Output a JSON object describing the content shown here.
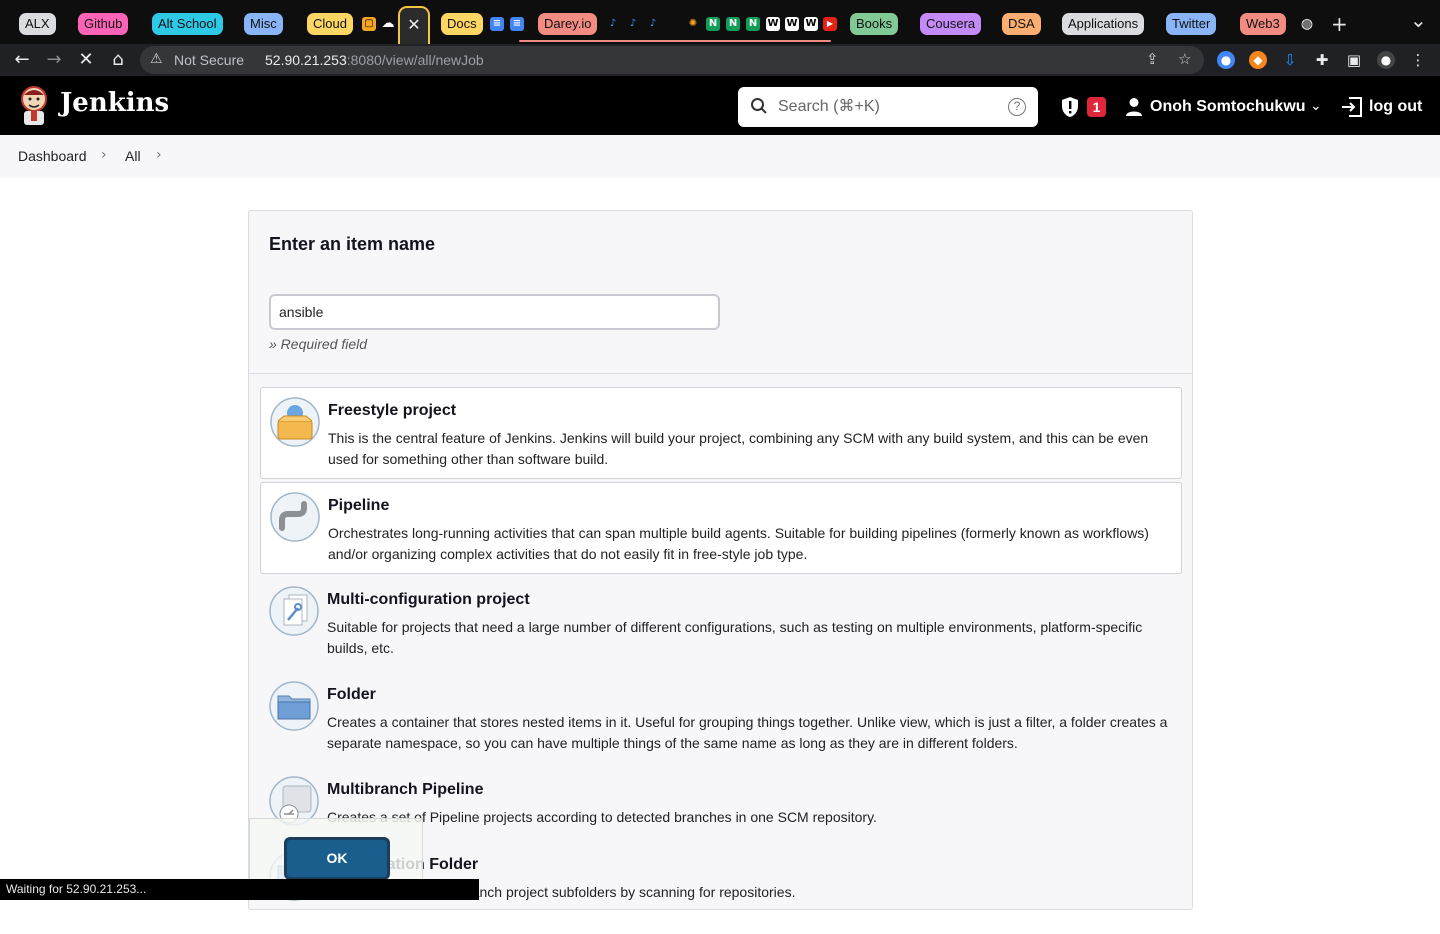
{
  "browser": {
    "tab_groups": [
      {
        "label": "ALX",
        "color": "#dadce0"
      },
      {
        "label": "Github",
        "color": "#ff63b8"
      },
      {
        "label": "Alt School",
        "color": "#2ec9e6"
      },
      {
        "label": "Misc",
        "color": "#8ab4f8"
      },
      {
        "label": "Cloud",
        "color": "#fdd663"
      },
      {
        "label": "Docs",
        "color": "#fdd663"
      },
      {
        "label": "Darey.io",
        "color": "#f28b82"
      },
      {
        "label": "Books",
        "color": "#81c995"
      },
      {
        "label": "Cousera",
        "color": "#c58af9"
      },
      {
        "label": "DSA",
        "color": "#fcad70"
      },
      {
        "label": "Applications",
        "color": "#dadce0"
      },
      {
        "label": "Twitter",
        "color": "#8ab4f8"
      },
      {
        "label": "Web3",
        "color": "#f28b82"
      }
    ],
    "active_tab_close": "✕",
    "new_tab": "+",
    "tab_list": "⌄",
    "address": {
      "security_label": "Not Secure",
      "host": "52.90.21.253",
      "path": ":8080/view/all/newJob"
    }
  },
  "jenkins": {
    "brand": "Jenkins",
    "search_placeholder": "Search (⌘+K)",
    "search_help": "?",
    "alert_count": "1",
    "user_name": "Onoh Somtochukwu",
    "logout_label": "log out"
  },
  "breadcrumb": {
    "items": [
      "Dashboard",
      "All"
    ]
  },
  "new_item": {
    "title": "Enter an item name",
    "name_value": "ansible",
    "required_hint": "» Required field",
    "types": [
      {
        "name": "Freestyle project",
        "desc": "This is the central feature of Jenkins. Jenkins will build your project, combining any SCM with any build system, and this can be even used for something other than software build.",
        "icon": "freestyle-project-icon"
      },
      {
        "name": "Pipeline",
        "desc": "Orchestrates long-running activities that can span multiple build agents. Suitable for building pipelines (formerly known as workflows) and/or organizing complex activities that do not easily fit in free-style job type.",
        "icon": "pipeline-icon"
      },
      {
        "name": "Multi-configuration project",
        "desc": "Suitable for projects that need a large number of different configurations, such as testing on multiple environments, platform-specific builds, etc.",
        "icon": "multi-configuration-icon"
      },
      {
        "name": "Folder",
        "desc": "Creates a container that stores nested items in it. Useful for grouping things together. Unlike view, which is just a filter, a folder creates a separate namespace, so you can have multiple things of the same name as long as they are in different folders.",
        "icon": "folder-icon"
      },
      {
        "name": "Multibranch Pipeline",
        "desc": "Creates a set of Pipeline projects according to detected branches in one SCM repository.",
        "icon": "multibranch-pipeline-icon"
      },
      {
        "name": "Organization Folder",
        "desc": "Creates a set of multibranch project subfolders by scanning for repositories.",
        "icon": "organization-folder-icon"
      }
    ],
    "ok_label": "OK"
  },
  "status_bar": "Waiting for 52.90.21.253..."
}
